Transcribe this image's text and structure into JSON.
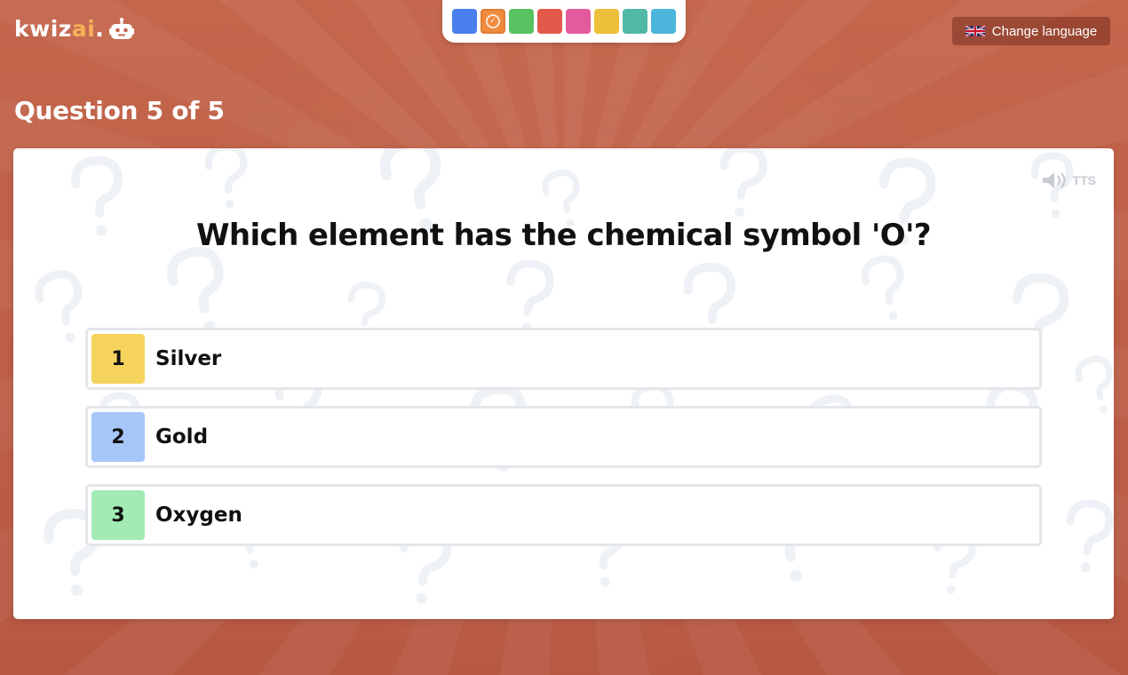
{
  "app": {
    "logo_main": "kwiz",
    "logo_accent": "ai",
    "logo_dot": "."
  },
  "progress": {
    "steps": [
      {
        "color": "#4a7fee",
        "state": "default"
      },
      {
        "color": "#f08a3c",
        "state": "current-answered"
      },
      {
        "color": "#58c160",
        "state": "default"
      },
      {
        "color": "#e35a4a",
        "state": "default"
      },
      {
        "color": "#e35b9c",
        "state": "default"
      },
      {
        "color": "#ecc03a",
        "state": "default"
      },
      {
        "color": "#52b8a6",
        "state": "default"
      },
      {
        "color": "#4bb5dc",
        "state": "default"
      }
    ]
  },
  "header": {
    "language_button": "Change language",
    "language_icon": "uk-flag-icon"
  },
  "quiz": {
    "counter": "Question 5 of 5",
    "tts_label": "TTS",
    "question": "Which element has the chemical symbol 'O'?",
    "answers": [
      {
        "number": "1",
        "label": "Silver",
        "color": "#f5d35c"
      },
      {
        "number": "2",
        "label": "Gold",
        "color": "#a5c6f7"
      },
      {
        "number": "3",
        "label": "Oxygen",
        "color": "#a2ebb4"
      }
    ]
  },
  "colors": {
    "background": "#b95b43",
    "accent": "#f6b15a"
  }
}
